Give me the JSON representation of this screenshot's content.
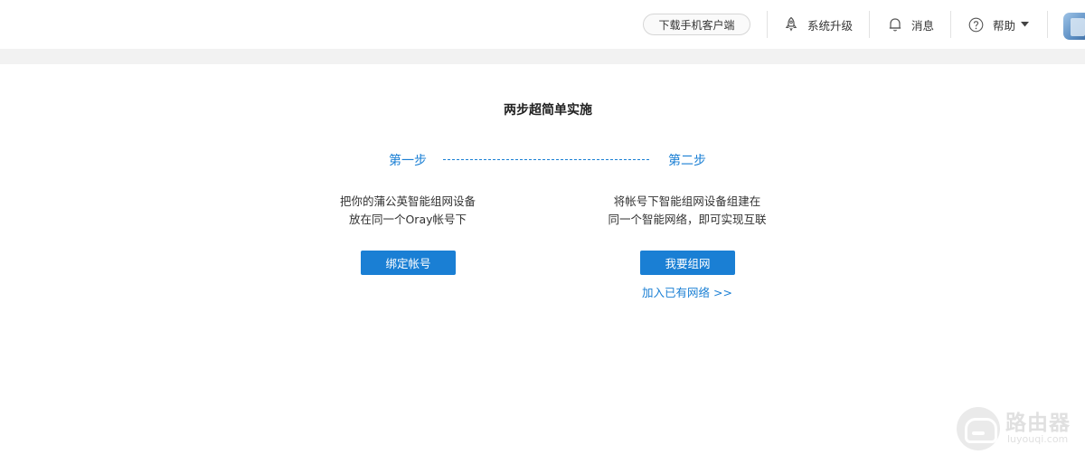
{
  "header": {
    "download_app": "下载手机客户端",
    "upgrade": {
      "label": "系统升级",
      "icon": "rocket-icon"
    },
    "messages": {
      "label": "消息",
      "icon": "bell-icon"
    },
    "help": {
      "label": "帮助",
      "icon": "question-circle-icon"
    }
  },
  "main": {
    "title": "两步超简单实施",
    "step1": {
      "label": "第一步",
      "desc_line1": "把你的蒲公英智能组网设备",
      "desc_line2": "放在同一个Oray帐号下",
      "button": "绑定帐号"
    },
    "step2": {
      "label": "第二步",
      "desc_line1": "将帐号下智能组网设备组建在",
      "desc_line2": "同一个智能网络，即可实现互联",
      "button": "我要组网",
      "link": "加入已有网络 >>"
    }
  },
  "watermark": {
    "text": "路由器",
    "sub": "luyouqi.com"
  },
  "colors": {
    "accent": "#1a7fd4",
    "strip": "#f2f2f2"
  }
}
